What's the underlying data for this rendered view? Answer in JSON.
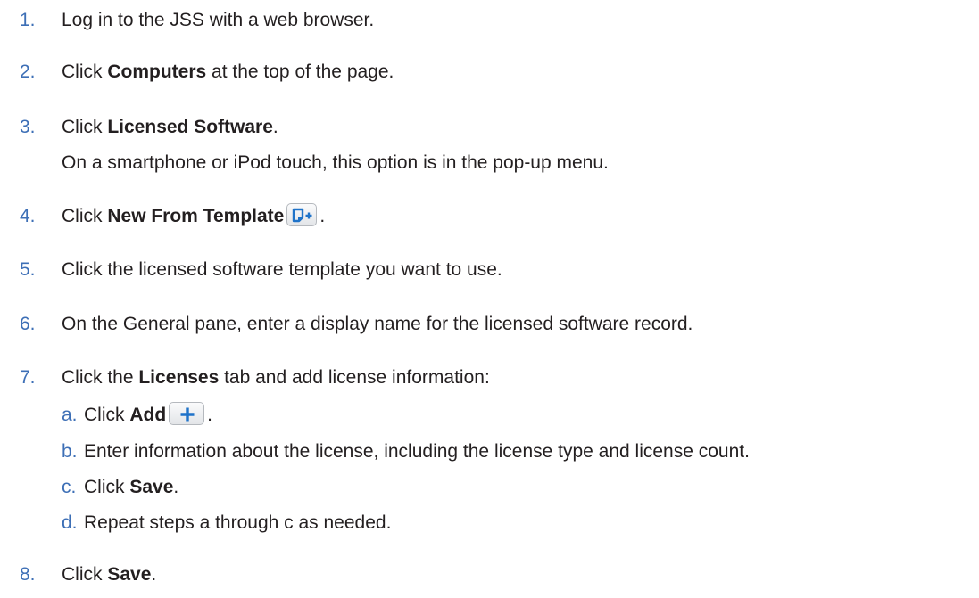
{
  "colors": {
    "step_number": "#3d6fb6",
    "body_text": "#231f20",
    "icon_blue": "#1f73c9"
  },
  "steps": [
    {
      "num": "1.",
      "pre": "Log in to the JSS with a web browser."
    },
    {
      "num": "2.",
      "pre": "Click ",
      "bold": "Computers",
      "post": " at the top of the page."
    },
    {
      "num": "3.",
      "pre": "Click ",
      "bold": "Licensed Software",
      "post": ".",
      "note": "On a smartphone or iPod touch, this option is in the pop-up menu."
    },
    {
      "num": "4.",
      "pre": "Click ",
      "bold": "New From Template",
      "icon": "new-from-template-icon",
      "post": "."
    },
    {
      "num": "5.",
      "pre": "Click the licensed software template you want to use."
    },
    {
      "num": "6.",
      "pre": "On the General pane, enter a display name for the licensed software record."
    },
    {
      "num": "7.",
      "pre": "Click the ",
      "bold": "Licenses",
      "post": " tab and add license information:",
      "substeps": [
        {
          "num": "a.",
          "pre": "Click ",
          "bold": "Add",
          "icon": "plus-icon",
          "post": "."
        },
        {
          "num": "b.",
          "pre": "Enter information about the license, including the license type and license count."
        },
        {
          "num": "c.",
          "pre": "Click ",
          "bold": "Save",
          "post": "."
        },
        {
          "num": "d.",
          "pre": "Repeat steps a through c as needed."
        }
      ]
    },
    {
      "num": "8.",
      "pre": "Click ",
      "bold": "Save",
      "post": "."
    }
  ]
}
